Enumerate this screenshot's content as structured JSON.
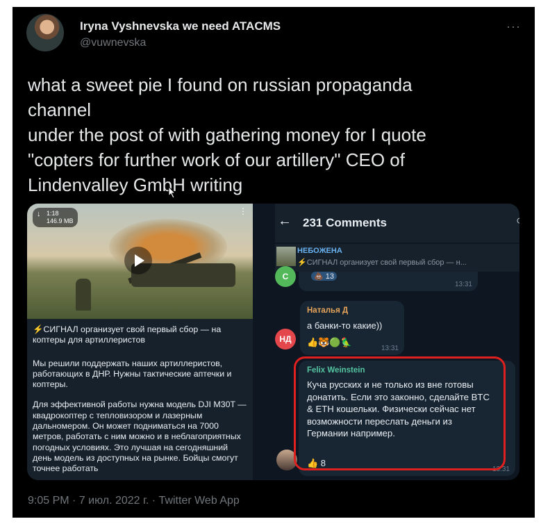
{
  "tweet": {
    "display_name": "Iryna Vyshnevska we need ATACMS",
    "handle": "@vuwnevska",
    "more_icon": "more-dots-icon",
    "text_lines": [
      "what a sweet pie I found on russian propaganda",
      "channel",
      "under the post of with gathering money for I quote",
      "\"copters for further work of our artillery\" CEO of",
      "Lindenvalley GmbH writing"
    ],
    "footer": "9:05 PM · 7 июл. 2022 г. · Twitter Web App"
  },
  "telegram_post": {
    "video_duration": "1:18",
    "video_size": "146.9 MB",
    "title": "⚡СИГНАЛ организует свой первый сбор — на коптеры для артиллеристов",
    "p1": "Мы решили поддержать наших артиллеристов, работающих в ДНР. Нужны тактические аптечки и коптеры.",
    "p2": "Для эффективной работы нужна модель DJI M30T — квадрокоптер с тепловизором и лазерным дальномером. Он может подниматься на 7000 метров, работать с ним можно и в неблагоприятных погодных условиях. Это лучшая на сегодняшний день модель из доступных на рынке. Бойцы смогут точнее работать"
  },
  "comments_panel": {
    "header_title": "231 Comments",
    "pinned_name": "НЕБОЖЕНА",
    "pinned_snippet": "⚡СИГНАЛ организует свой первый сбор — н...",
    "comment1": {
      "avatar_letter": "С",
      "reaction": "💩 13",
      "time": "13:31"
    },
    "comment2": {
      "avatar_letter": "НД",
      "sender": "Наталья Д",
      "text": "а банки-то какие))",
      "reactions": "👍🐯🟢🦜",
      "time": "13:31"
    },
    "comment3": {
      "sender": "Felix Weinstein",
      "text": "Куча русских и не только из вне готовы донатить. Если это законно, сделайте BTC & ETH кошельки. Физически сейчас нет возможности переслать деньги из Германии например.",
      "reaction": "👍 8",
      "time": "13:31"
    }
  },
  "colors": {
    "tweet_bg": "#000000",
    "telegram_bg": "#0e1621",
    "highlight": "#e0201e",
    "link_blue": "#6ab3f3"
  }
}
